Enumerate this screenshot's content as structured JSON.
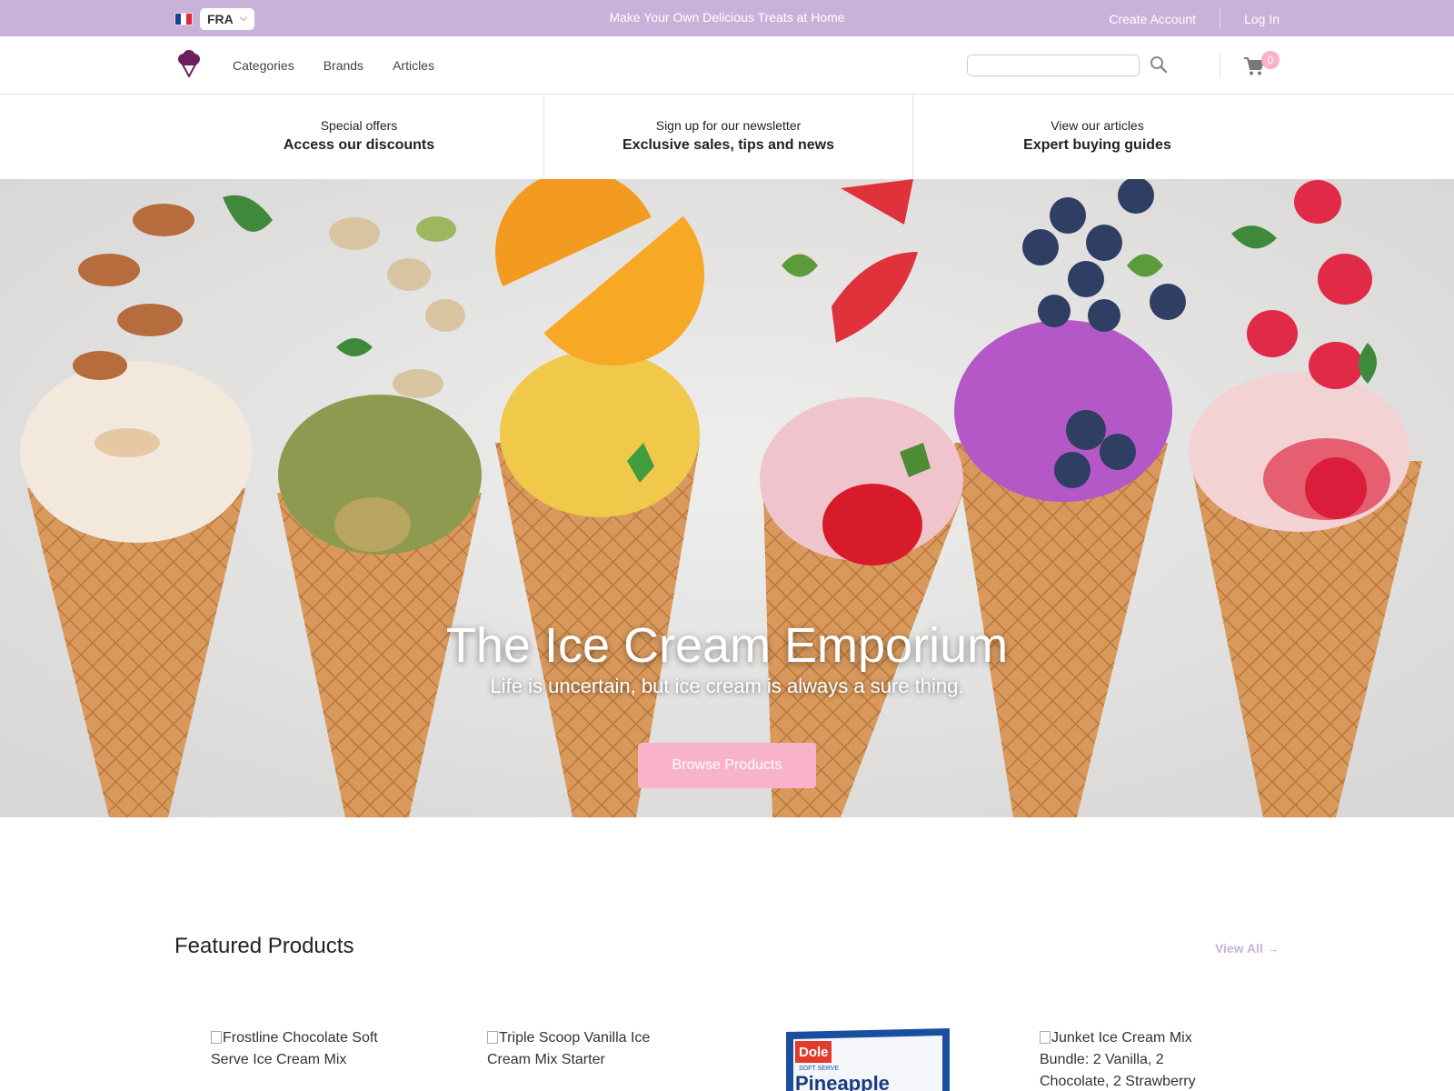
{
  "topbar": {
    "language_code": "FRA",
    "promo_text": "Make Your Own Delicious Treats at Home",
    "create_account": "Create Account",
    "log_in": "Log In"
  },
  "nav": {
    "items": [
      "Categories",
      "Brands",
      "Articles"
    ],
    "search_value": "",
    "cart_count": "0"
  },
  "strip": [
    {
      "subtitle": "Special offers",
      "title": "Access our discounts"
    },
    {
      "subtitle": "Sign up for our newsletter",
      "title": "Exclusive sales, tips and news"
    },
    {
      "subtitle": "View our articles",
      "title": "Expert buying guides"
    }
  ],
  "hero": {
    "title": "The Ice Cream Emporium",
    "subtitle": "Life is uncertain, but ice cream is always a sure thing.",
    "button": "Browse Products"
  },
  "featured": {
    "title": "Featured Products",
    "view_all": "View All →",
    "products": [
      {
        "name": "Frostline Chocolate Soft Serve Ice Cream Mix"
      },
      {
        "name": "Triple Scoop Vanilla Ice Cream Mix Starter"
      },
      {
        "name": "Dole Pineapple Soft Serve"
      },
      {
        "name": "Junket Ice Cream Mix Bundle: 2 Vanilla, 2 Chocolate, 2 Strawberry"
      }
    ],
    "package_brand": "Dole",
    "package_label": "SOFT SERVE",
    "package_flavor": "Pineapple"
  },
  "colors": {
    "topbar": "#c9b2da",
    "accent_pink": "#f8b2c9",
    "logo_purple": "#6a1f5e"
  }
}
